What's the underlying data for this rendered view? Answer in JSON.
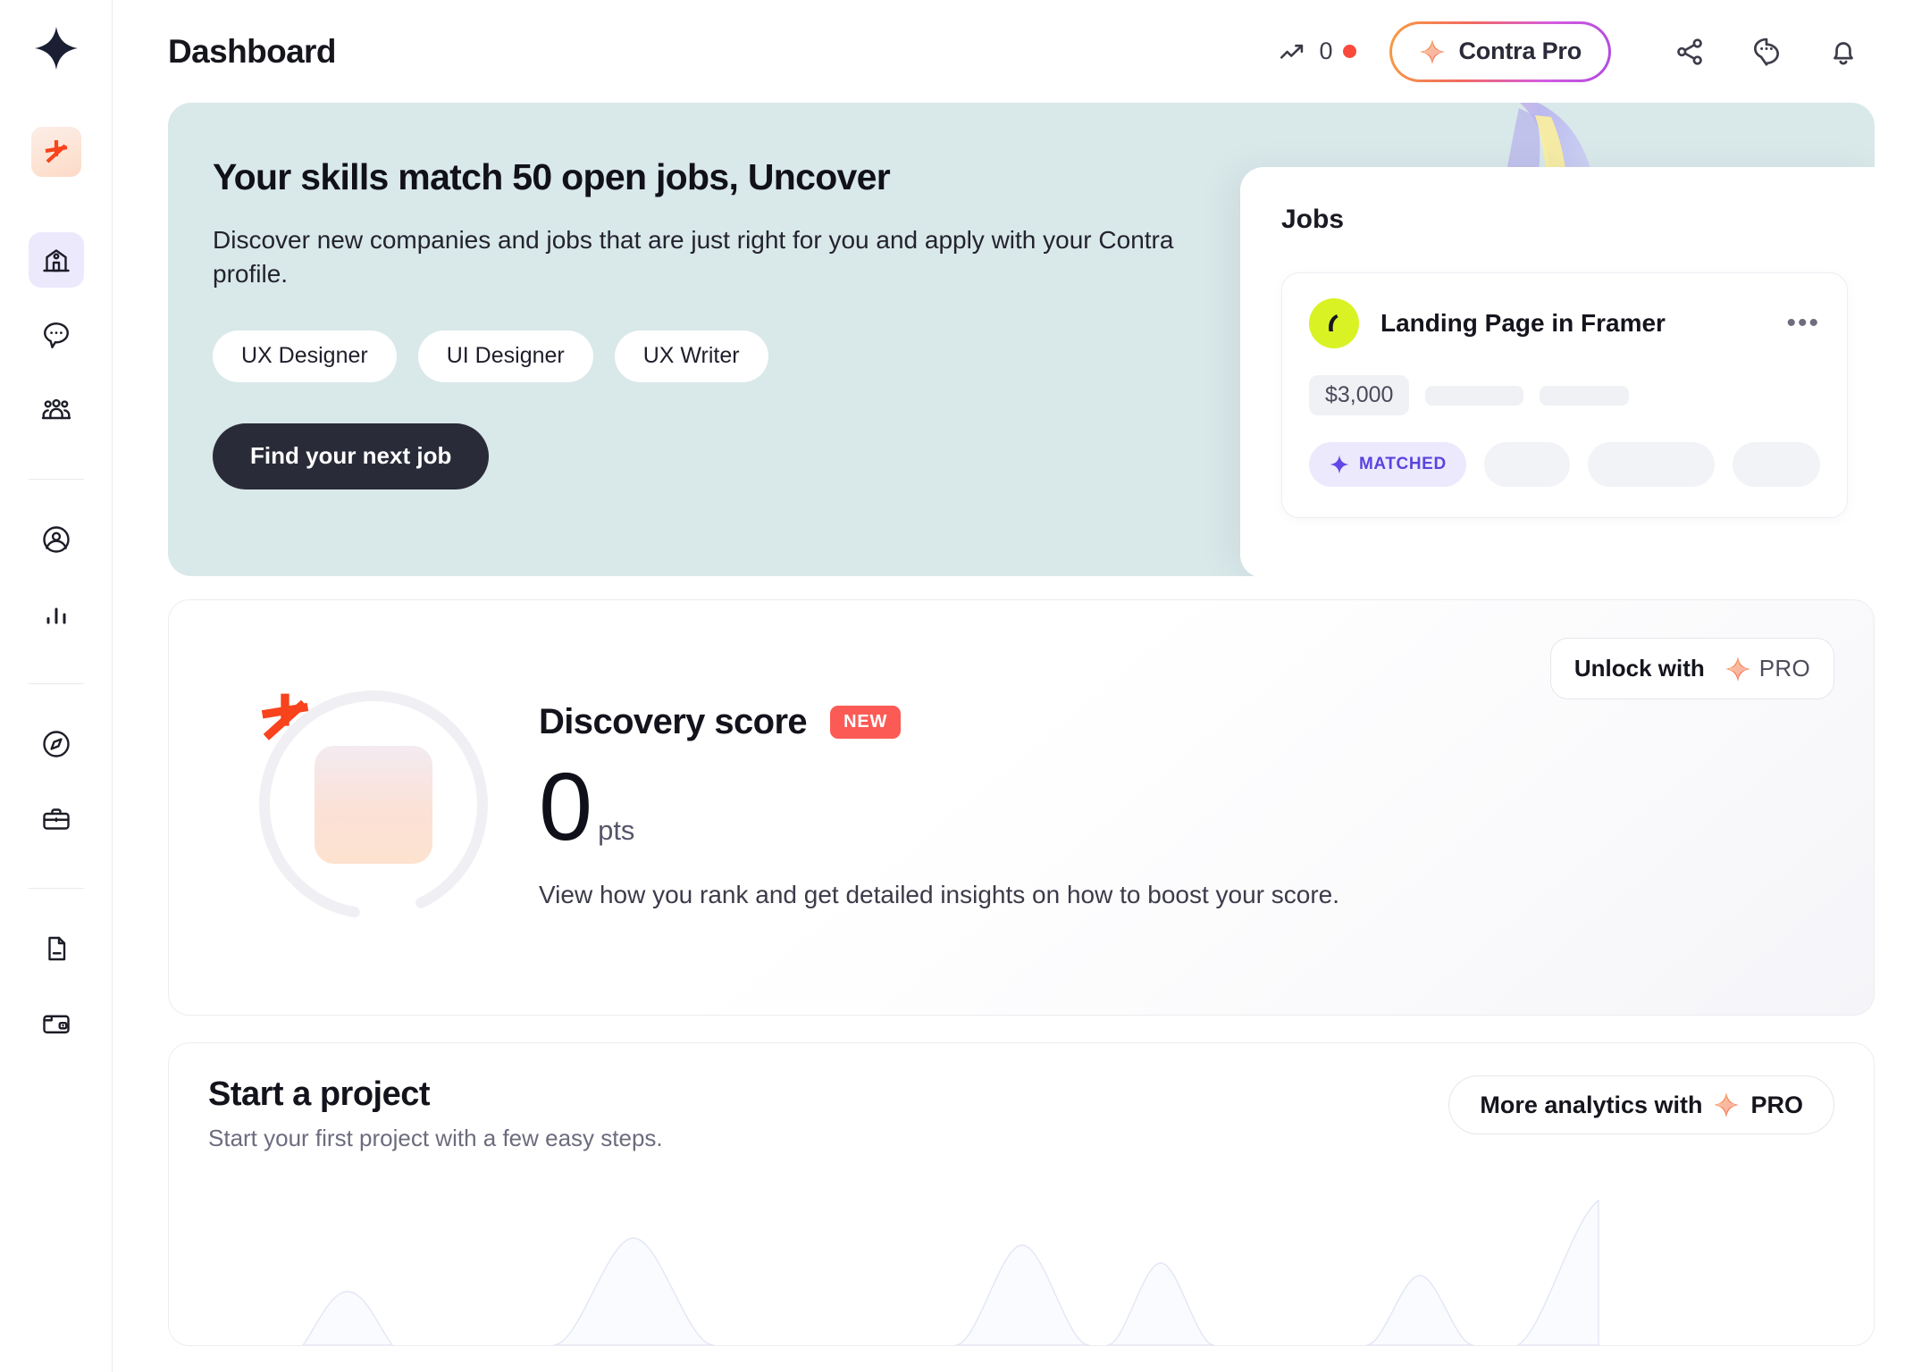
{
  "app": {
    "brand_logo_icon": "contra-star-logo",
    "page_title": "Dashboard"
  },
  "sidebar": {
    "avatar_icon": "contra-asterisk-avatar",
    "groups": [
      {
        "items": [
          {
            "icon": "home-icon",
            "name": "home",
            "active": true
          },
          {
            "icon": "chat-bubble-icon",
            "name": "messages",
            "active": false
          },
          {
            "icon": "people-group-icon",
            "name": "teams",
            "active": false
          }
        ]
      },
      {
        "items": [
          {
            "icon": "user-circle-icon",
            "name": "profile",
            "active": false
          },
          {
            "icon": "bar-chart-icon",
            "name": "analytics",
            "active": false
          }
        ]
      },
      {
        "items": [
          {
            "icon": "compass-icon",
            "name": "discover",
            "active": false
          },
          {
            "icon": "briefcase-icon",
            "name": "opportunities",
            "active": false
          }
        ]
      },
      {
        "items": [
          {
            "icon": "document-icon",
            "name": "invoices",
            "active": false
          },
          {
            "icon": "wallet-icon",
            "name": "wallet",
            "active": false
          }
        ]
      }
    ]
  },
  "topbar": {
    "trend_icon": "trending-up-icon",
    "trend_value": "0",
    "status_dot_color": "#fa4a3c",
    "pro_button": {
      "label": "Contra Pro",
      "icon": "pro-sparkle-icon"
    },
    "actions": [
      {
        "icon": "share-icon",
        "name": "share"
      },
      {
        "icon": "chat-bubble-icon",
        "name": "support-chat"
      },
      {
        "icon": "bell-icon",
        "name": "notifications"
      }
    ]
  },
  "hero": {
    "background_color": "#d9e8e9",
    "title": "Your skills match 50 open jobs, Uncover",
    "subtitle": "Discover new companies and jobs that are just right for you and apply with your Contra profile.",
    "chips": [
      "UX Designer",
      "UI Designer",
      "UX Writer"
    ],
    "cta_label": "Find your next job",
    "jobs_panel": {
      "label": "Jobs",
      "job": {
        "avatar_icon": "framer-logo-avatar",
        "avatar_color": "#d9f224",
        "title": "Landing Page in Framer",
        "menu_icon": "more-horizontal-icon",
        "price": "$3,000",
        "matched_label": "MATCHED",
        "matched_icon": "matched-star-icon",
        "matched_color": "#5a44dd"
      }
    }
  },
  "discovery": {
    "ring_icon": "contra-asterisk-icon",
    "title": "Discovery score",
    "badge": "NEW",
    "badge_color": "#fc5a55",
    "score": "0",
    "score_unit": "pts",
    "description": "View how you rank and get detailed insights on how to boost your score.",
    "unlock_button": {
      "label": "Unlock with",
      "pro_text": "PRO",
      "pro_icon": "pro-sparkle-icon"
    }
  },
  "project": {
    "title": "Start a project",
    "subtitle": "Start your first project with a few easy steps.",
    "analytics_button": {
      "label": "More analytics with",
      "pro_text": "PRO",
      "pro_icon": "pro-sparkle-icon"
    }
  }
}
